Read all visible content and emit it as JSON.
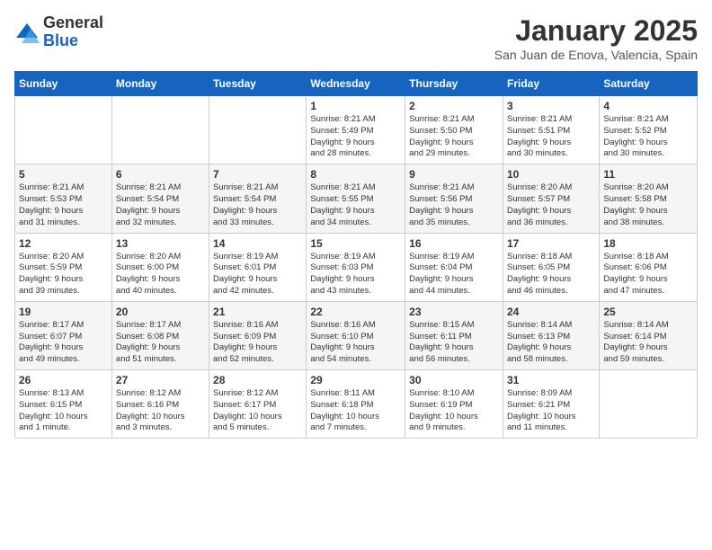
{
  "logo": {
    "general": "General",
    "blue": "Blue"
  },
  "header": {
    "title": "January 2025",
    "location": "San Juan de Enova, Valencia, Spain"
  },
  "days_of_week": [
    "Sunday",
    "Monday",
    "Tuesday",
    "Wednesday",
    "Thursday",
    "Friday",
    "Saturday"
  ],
  "weeks": [
    [
      {
        "day": "",
        "info": ""
      },
      {
        "day": "",
        "info": ""
      },
      {
        "day": "",
        "info": ""
      },
      {
        "day": "1",
        "info": "Sunrise: 8:21 AM\nSunset: 5:49 PM\nDaylight: 9 hours\nand 28 minutes."
      },
      {
        "day": "2",
        "info": "Sunrise: 8:21 AM\nSunset: 5:50 PM\nDaylight: 9 hours\nand 29 minutes."
      },
      {
        "day": "3",
        "info": "Sunrise: 8:21 AM\nSunset: 5:51 PM\nDaylight: 9 hours\nand 30 minutes."
      },
      {
        "day": "4",
        "info": "Sunrise: 8:21 AM\nSunset: 5:52 PM\nDaylight: 9 hours\nand 30 minutes."
      }
    ],
    [
      {
        "day": "5",
        "info": "Sunrise: 8:21 AM\nSunset: 5:53 PM\nDaylight: 9 hours\nand 31 minutes."
      },
      {
        "day": "6",
        "info": "Sunrise: 8:21 AM\nSunset: 5:54 PM\nDaylight: 9 hours\nand 32 minutes."
      },
      {
        "day": "7",
        "info": "Sunrise: 8:21 AM\nSunset: 5:54 PM\nDaylight: 9 hours\nand 33 minutes."
      },
      {
        "day": "8",
        "info": "Sunrise: 8:21 AM\nSunset: 5:55 PM\nDaylight: 9 hours\nand 34 minutes."
      },
      {
        "day": "9",
        "info": "Sunrise: 8:21 AM\nSunset: 5:56 PM\nDaylight: 9 hours\nand 35 minutes."
      },
      {
        "day": "10",
        "info": "Sunrise: 8:20 AM\nSunset: 5:57 PM\nDaylight: 9 hours\nand 36 minutes."
      },
      {
        "day": "11",
        "info": "Sunrise: 8:20 AM\nSunset: 5:58 PM\nDaylight: 9 hours\nand 38 minutes."
      }
    ],
    [
      {
        "day": "12",
        "info": "Sunrise: 8:20 AM\nSunset: 5:59 PM\nDaylight: 9 hours\nand 39 minutes."
      },
      {
        "day": "13",
        "info": "Sunrise: 8:20 AM\nSunset: 6:00 PM\nDaylight: 9 hours\nand 40 minutes."
      },
      {
        "day": "14",
        "info": "Sunrise: 8:19 AM\nSunset: 6:01 PM\nDaylight: 9 hours\nand 42 minutes."
      },
      {
        "day": "15",
        "info": "Sunrise: 8:19 AM\nSunset: 6:03 PM\nDaylight: 9 hours\nand 43 minutes."
      },
      {
        "day": "16",
        "info": "Sunrise: 8:19 AM\nSunset: 6:04 PM\nDaylight: 9 hours\nand 44 minutes."
      },
      {
        "day": "17",
        "info": "Sunrise: 8:18 AM\nSunset: 6:05 PM\nDaylight: 9 hours\nand 46 minutes."
      },
      {
        "day": "18",
        "info": "Sunrise: 8:18 AM\nSunset: 6:06 PM\nDaylight: 9 hours\nand 47 minutes."
      }
    ],
    [
      {
        "day": "19",
        "info": "Sunrise: 8:17 AM\nSunset: 6:07 PM\nDaylight: 9 hours\nand 49 minutes."
      },
      {
        "day": "20",
        "info": "Sunrise: 8:17 AM\nSunset: 6:08 PM\nDaylight: 9 hours\nand 51 minutes."
      },
      {
        "day": "21",
        "info": "Sunrise: 8:16 AM\nSunset: 6:09 PM\nDaylight: 9 hours\nand 52 minutes."
      },
      {
        "day": "22",
        "info": "Sunrise: 8:16 AM\nSunset: 6:10 PM\nDaylight: 9 hours\nand 54 minutes."
      },
      {
        "day": "23",
        "info": "Sunrise: 8:15 AM\nSunset: 6:11 PM\nDaylight: 9 hours\nand 56 minutes."
      },
      {
        "day": "24",
        "info": "Sunrise: 8:14 AM\nSunset: 6:13 PM\nDaylight: 9 hours\nand 58 minutes."
      },
      {
        "day": "25",
        "info": "Sunrise: 8:14 AM\nSunset: 6:14 PM\nDaylight: 9 hours\nand 59 minutes."
      }
    ],
    [
      {
        "day": "26",
        "info": "Sunrise: 8:13 AM\nSunset: 6:15 PM\nDaylight: 10 hours\nand 1 minute."
      },
      {
        "day": "27",
        "info": "Sunrise: 8:12 AM\nSunset: 6:16 PM\nDaylight: 10 hours\nand 3 minutes."
      },
      {
        "day": "28",
        "info": "Sunrise: 8:12 AM\nSunset: 6:17 PM\nDaylight: 10 hours\nand 5 minutes."
      },
      {
        "day": "29",
        "info": "Sunrise: 8:11 AM\nSunset: 6:18 PM\nDaylight: 10 hours\nand 7 minutes."
      },
      {
        "day": "30",
        "info": "Sunrise: 8:10 AM\nSunset: 6:19 PM\nDaylight: 10 hours\nand 9 minutes."
      },
      {
        "day": "31",
        "info": "Sunrise: 8:09 AM\nSunset: 6:21 PM\nDaylight: 10 hours\nand 11 minutes."
      },
      {
        "day": "",
        "info": ""
      }
    ]
  ]
}
